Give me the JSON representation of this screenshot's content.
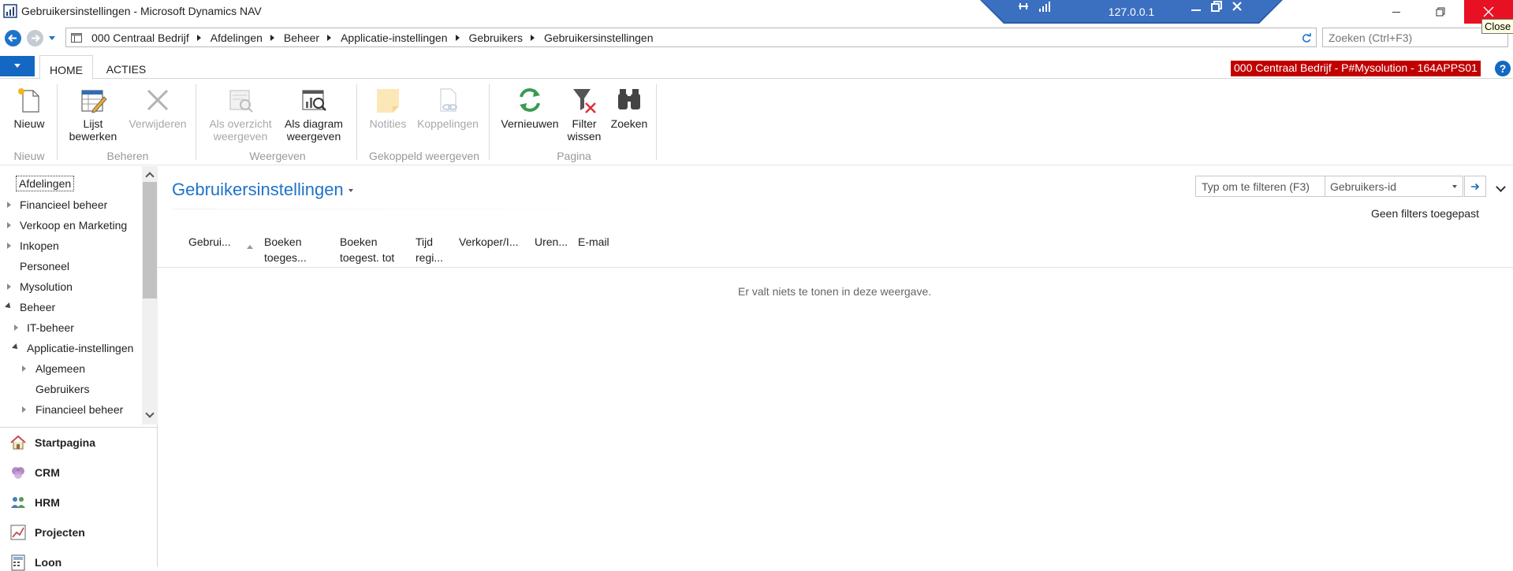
{
  "window": {
    "title": "Gebruikersinstellingen - Microsoft Dynamics NAV",
    "close_tooltip": "Close"
  },
  "rdp": {
    "ip": "127.0.0.1"
  },
  "address_bar": {
    "breadcrumb": [
      "000 Centraal Bedrijf",
      "Afdelingen",
      "Beheer",
      "Applicatie-instellingen",
      "Gebruikers",
      "Gebruikersinstellingen"
    ],
    "search_placeholder": "Zoeken (Ctrl+F3)"
  },
  "ribbon_tabs": {
    "home": "HOME",
    "acties": "ACTIES"
  },
  "company_badge": "000 Centraal Bedrijf - P#Mysolution - 164APPS01",
  "ribbon": {
    "nieuw": "Nieuw",
    "lijst_bewerken": [
      "Lijst",
      "bewerken"
    ],
    "verwijderen": "Verwijderen",
    "als_overzicht": [
      "Als overzicht",
      "weergeven"
    ],
    "als_diagram": [
      "Als diagram",
      "weergeven"
    ],
    "notities": "Notities",
    "koppelingen": "Koppelingen",
    "vernieuwen": "Vernieuwen",
    "filter_wissen": [
      "Filter",
      "wissen"
    ],
    "zoeken": "Zoeken",
    "groups": {
      "nieuw": "Nieuw",
      "beheren": "Beheren",
      "weergeven": "Weergeven",
      "gekoppeld": "Gekoppeld weergeven",
      "pagina": "Pagina"
    }
  },
  "nav_tree": {
    "afdelingen": "Afdelingen",
    "financieel_beheer": "Financieel beheer",
    "verkoop_marketing": "Verkoop en Marketing",
    "inkopen": "Inkopen",
    "personeel": "Personeel",
    "mysolution": "Mysolution",
    "beheer": "Beheer",
    "it_beheer": "IT-beheer",
    "applicatie_instellingen": "Applicatie-instellingen",
    "algemeen": "Algemeen",
    "gebruikers": "Gebruikers",
    "financieel_beheer_sub": "Financieel beheer"
  },
  "nav_sections": {
    "startpagina": "Startpagina",
    "crm": "CRM",
    "hrm": "HRM",
    "projecten": "Projecten",
    "loon": "Loon"
  },
  "page": {
    "title": "Gebruikersinstellingen",
    "filter_placeholder": "Typ om te filteren (F3)",
    "filter_field": "Gebruikers-id",
    "no_filters": "Geen filters toegepast",
    "empty_message": "Er valt niets te tonen in deze weergave."
  },
  "columns": [
    [
      "Gebrui..."
    ],
    [
      "Boeken",
      "toeges..."
    ],
    [
      "Boeken",
      "toegest. tot"
    ],
    [
      "Tijd",
      "regi..."
    ],
    [
      "Verkoper/I..."
    ],
    [
      "Uren..."
    ],
    [
      "E-mail"
    ]
  ],
  "colors": {
    "accent": "#1e73c9",
    "badge": "#c00000",
    "close_red": "#e81123",
    "rdp_bar": "#2a5caa"
  }
}
